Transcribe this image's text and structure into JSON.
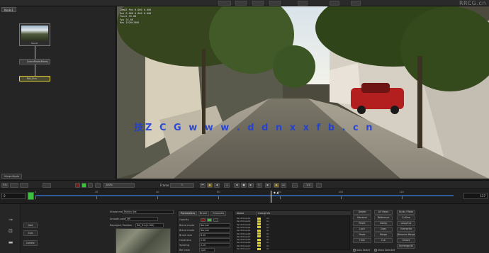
{
  "header": {
    "logo": "RRCG.cn"
  },
  "node_graph": {
    "tab_label": "Node1",
    "thumbnail_label": "Read1",
    "nodes": [
      {
        "label": "QuickPaint(Paint)"
      },
      {
        "label": "Ref_Frm"
      }
    ],
    "footer_label": "ViewerNode"
  },
  "viewer": {
    "overlay_lines": [
      "Cam01 Pos 0.000 0.000",
      "Rot 0.000 0.000 0.000",
      "Focal 35.00",
      "Fps 24.00",
      "Res 1920x1080"
    ],
    "watermark": "技Z C G   w w w . d d n x x f b . c n"
  },
  "transport": {
    "frame_left": "5%",
    "frame_label": "Frame",
    "frame_value": "1",
    "proxy": "1/4",
    "zoom": "100%"
  },
  "timeline": {
    "start": "0",
    "end": "137",
    "current_marker": "◆ ▲",
    "ticks": [
      "0",
      "20",
      "40",
      "60",
      "80",
      "100",
      "120"
    ],
    "current_frame": 77,
    "range_end": 137
  },
  "bottom": {
    "left_buttons": [
      "Add",
      "Sub",
      "Delete"
    ],
    "props": {
      "rows": [
        {
          "label": "Stroke mode",
          "value": "Paint a line"
        },
        {
          "label": "Smooth points",
          "value": "Off"
        },
        {
          "label": "Reproject Position",
          "value": "Ref_Frm(1-100)"
        }
      ]
    },
    "tabs": [
      {
        "label": "Parameters",
        "active": true
      },
      {
        "label": "Brush",
        "active": false
      },
      {
        "label": "Channels",
        "active": false
      }
    ],
    "tab_rows": [
      {
        "label": "Opacity",
        "value": ""
      },
      {
        "label": "Blend mode",
        "value": "Normal"
      },
      {
        "label": "Blend mode",
        "value": "Normal"
      },
      {
        "label": "Brush size",
        "value": "8.00"
      },
      {
        "label": "Hardness",
        "value": "0.50"
      },
      {
        "label": "Spacing",
        "value": "0.10"
      },
      {
        "label": "Ref view",
        "value": "1/10"
      },
      {
        "label": "Lifetime",
        "value": "All"
      }
    ],
    "swatches": [
      "#7a1e1e",
      "#3fbf3f",
      "#2f2f2f"
    ],
    "table": {
      "headers": [
        "Name",
        "Colour",
        "Vis"
      ],
      "rows": [
        {
          "name": "PaintStroke01",
          "vis": "On"
        },
        {
          "name": "PaintStroke02",
          "vis": "On"
        },
        {
          "name": "PaintStroke03",
          "vis": "On"
        },
        {
          "name": "PaintStroke04",
          "vis": "On"
        },
        {
          "name": "PaintStroke05",
          "vis": "On"
        },
        {
          "name": "PaintStroke06",
          "vis": "On"
        },
        {
          "name": "PaintStroke07",
          "vis": "On"
        },
        {
          "name": "PaintStroke08",
          "vis": "On"
        },
        {
          "name": "PaintStroke09",
          "vis": "On"
        },
        {
          "name": "PaintStroke10",
          "vis": "On"
        },
        {
          "name": "PaintStroke11",
          "vis": "On"
        }
      ]
    },
    "right_buttons": [
      [
        "Delete",
        "All Views",
        "Undo / Redo"
      ],
      [
        "Rename",
        "Reference",
        "Cutline"
      ],
      [
        "Reset",
        "Clamp",
        "Loop/Cut"
      ],
      [
        "Lock",
        "Copy",
        "Overwrite"
      ],
      [
        "Paste",
        "Merge",
        "Rename Merge"
      ],
      [
        "Hide",
        "Cut",
        "Unlock"
      ],
      [
        "",
        "",
        "Unmerge All"
      ]
    ],
    "radios": [
      "Auto Select",
      "Show Selected"
    ]
  }
}
